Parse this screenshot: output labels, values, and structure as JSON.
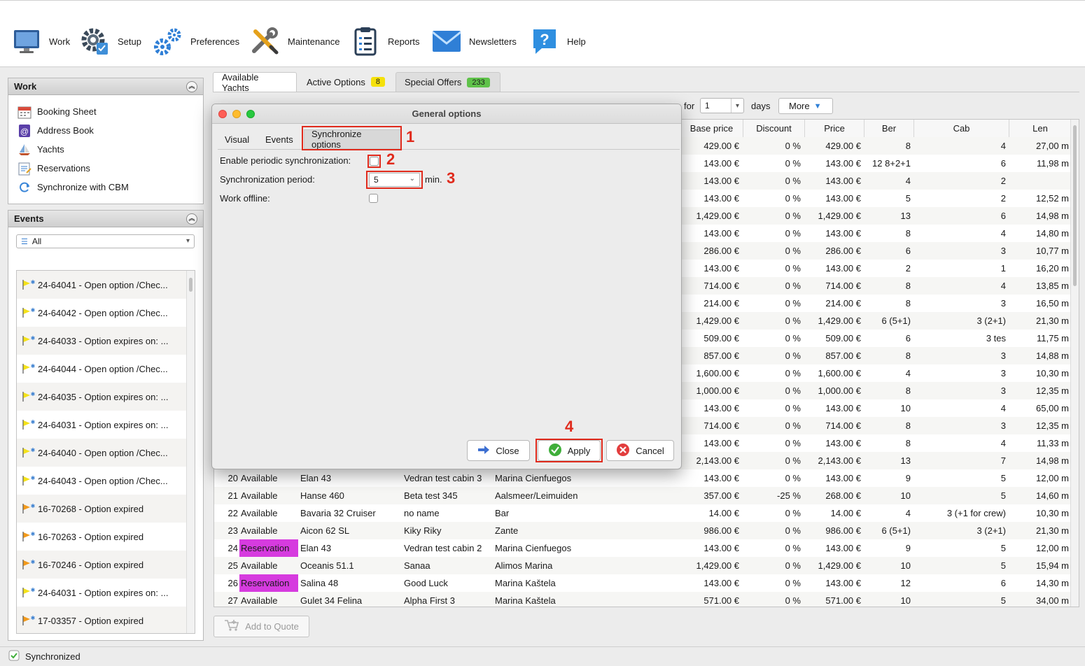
{
  "toolbar": {
    "items": [
      {
        "label": "Work",
        "icon": "monitor-icon"
      },
      {
        "label": "Setup",
        "icon": "gear-checklist-icon"
      },
      {
        "label": "Preferences",
        "icon": "gears-icon"
      },
      {
        "label": "Maintenance",
        "icon": "wrench-screwdriver-icon"
      },
      {
        "label": "Reports",
        "icon": "clipboard-icon"
      },
      {
        "label": "Newsletters",
        "icon": "envelope-icon"
      },
      {
        "label": "Help",
        "icon": "help-bubble-icon"
      }
    ]
  },
  "work_panel": {
    "title": "Work",
    "items": [
      {
        "label": "Booking Sheet",
        "icon": "calendar-icon"
      },
      {
        "label": "Address Book",
        "icon": "address-book-icon"
      },
      {
        "label": "Yachts",
        "icon": "sailboat-icon"
      },
      {
        "label": "Reservations",
        "icon": "notepad-icon"
      },
      {
        "label": "Synchronize with CBM",
        "icon": "sync-icon"
      }
    ]
  },
  "events_panel": {
    "title": "Events",
    "filter_value": "All",
    "events": [
      {
        "text": "24-64041 - Open option /Chec...",
        "flag": "yellow"
      },
      {
        "text": "24-64042 - Open option /Chec...",
        "flag": "yellow"
      },
      {
        "text": "24-64033 - Option expires on: ...",
        "flag": "yellow"
      },
      {
        "text": "24-64044 - Open option /Chec...",
        "flag": "yellow"
      },
      {
        "text": "24-64035 - Option expires on: ...",
        "flag": "yellow"
      },
      {
        "text": "24-64031 - Option expires on: ...",
        "flag": "yellow"
      },
      {
        "text": "24-64040 - Open option /Chec...",
        "flag": "yellow"
      },
      {
        "text": "24-64043 - Open option /Chec...",
        "flag": "yellow"
      },
      {
        "text": "16-70268 - Option expired",
        "flag": "orange"
      },
      {
        "text": "16-70263 - Option expired",
        "flag": "orange"
      },
      {
        "text": "16-70246 - Option expired",
        "flag": "orange"
      },
      {
        "text": "24-64031 - Option expires on: ...",
        "flag": "yellow"
      },
      {
        "text": "17-03357 - Option expired",
        "flag": "orange"
      }
    ]
  },
  "main_tabs": [
    {
      "label": "Available Yachts"
    },
    {
      "label": "Active Options",
      "badge": "8",
      "badge_color": "#f5e10a"
    },
    {
      "label": "Special Offers",
      "badge": "233",
      "badge_color": "#5fc24a"
    }
  ],
  "filters": {
    "for_label": "for",
    "days_value": "1",
    "days_label": "days",
    "more_label": "More"
  },
  "grid": {
    "columns": [
      "Base price",
      "Discount",
      "Price",
      "Ber",
      "Cab",
      "Len"
    ],
    "upper_rows": [
      [
        "429.00 €",
        "0 %",
        "429.00 €",
        "8",
        "4",
        "27,00 m"
      ],
      [
        "143.00 €",
        "0 %",
        "143.00 €",
        "12 8+2+1",
        "6",
        "11,98 m"
      ],
      [
        "143.00 €",
        "0 %",
        "143.00 €",
        "4",
        "2",
        ""
      ],
      [
        "143.00 €",
        "0 %",
        "143.00 €",
        "5",
        "2",
        "12,52 m"
      ],
      [
        "1,429.00 €",
        "0 %",
        "1,429.00 €",
        "13",
        "6",
        "14,98 m"
      ],
      [
        "143.00 €",
        "0 %",
        "143.00 €",
        "8",
        "4",
        "14,80 m"
      ],
      [
        "286.00 €",
        "0 %",
        "286.00 €",
        "6",
        "3",
        "10,77 m"
      ],
      [
        "143.00 €",
        "0 %",
        "143.00 €",
        "2",
        "1",
        "16,20 m"
      ],
      [
        "714.00 €",
        "0 %",
        "714.00 €",
        "8",
        "4",
        "13,85 m"
      ],
      [
        "214.00 €",
        "0 %",
        "214.00 €",
        "8",
        "3",
        "16,50 m"
      ],
      [
        "1,429.00 €",
        "0 %",
        "1,429.00 €",
        "6 (5+1)",
        "3 (2+1)",
        "21,30 m"
      ],
      [
        "509.00 €",
        "0 %",
        "509.00 €",
        "6",
        "3 tes",
        "11,75 m"
      ],
      [
        "857.00 €",
        "0 %",
        "857.00 €",
        "8",
        "3",
        "14,88 m"
      ],
      [
        "1,600.00 €",
        "0 %",
        "1,600.00 €",
        "4",
        "3",
        "10,30 m"
      ],
      [
        "1,000.00 €",
        "0 %",
        "1,000.00 €",
        "8",
        "3",
        "12,35 m"
      ],
      [
        "143.00 €",
        "0 %",
        "143.00 €",
        "10",
        "4",
        "65,00 m"
      ],
      [
        "714.00 €",
        "0 %",
        "714.00 €",
        "8",
        "3",
        "12,35 m"
      ],
      [
        "143.00 €",
        "0 %",
        "143.00 €",
        "8",
        "4",
        "11,33 m"
      ],
      [
        "2,143.00 €",
        "0 %",
        "2,143.00 €",
        "13",
        "7",
        "14,98 m"
      ]
    ],
    "lower_rows": [
      {
        "no": "20",
        "status": "Available",
        "model": "Elan 43",
        "name": "Vedran test cabin 3",
        "base": "Marina Cienfuegos",
        "base_price": "143.00 €",
        "discount": "0 %",
        "price": "143.00 €",
        "ber": "9",
        "cab": "5",
        "len": "12,00 m"
      },
      {
        "no": "21",
        "status": "Available",
        "model": "Hanse 460",
        "name": "Beta test 345",
        "base": "Aalsmeer/Leimuiden",
        "base_price": "357.00 €",
        "discount": "-25 %",
        "price": "268.00 €",
        "ber": "10",
        "cab": "5",
        "len": "14,60 m"
      },
      {
        "no": "22",
        "status": "Available",
        "model": "Bavaria 32 Cruiser",
        "name": "no name",
        "base": "Bar",
        "base_price": "14.00 €",
        "discount": "0 %",
        "price": "14.00 €",
        "ber": "4",
        "cab": "3 (+1 for crew)",
        "len": "10,30 m"
      },
      {
        "no": "23",
        "status": "Available",
        "model": "Aicon 62 SL",
        "name": "Kiky Riky",
        "base": "Zante",
        "base_price": "986.00 €",
        "discount": "0 %",
        "price": "986.00 €",
        "ber": "6 (5+1)",
        "cab": "3 (2+1)",
        "len": "21,30 m"
      },
      {
        "no": "24",
        "status": "Reservation",
        "model": "Elan 43",
        "name": "Vedran test cabin 2",
        "base": "Marina Cienfuegos",
        "base_price": "143.00 €",
        "discount": "0 %",
        "price": "143.00 €",
        "ber": "9",
        "cab": "5",
        "len": "12,00 m"
      },
      {
        "no": "25",
        "status": "Available",
        "model": "Oceanis 51.1",
        "name": "Sanaa",
        "base": "Alimos Marina",
        "base_price": "1,429.00 €",
        "discount": "0 %",
        "price": "1,429.00 €",
        "ber": "10",
        "cab": "5",
        "len": "15,94 m"
      },
      {
        "no": "26",
        "status": "Reservation",
        "model": "Salina 48",
        "name": "Good Luck",
        "base": "Marina Kaštela",
        "base_price": "143.00 €",
        "discount": "0 %",
        "price": "143.00 €",
        "ber": "12",
        "cab": "6",
        "len": "14,30 m"
      },
      {
        "no": "27",
        "status": "Available",
        "model": "Gulet 34 Felina",
        "name": "Alpha First 3",
        "base": "Marina Kaštela",
        "base_price": "571.00 €",
        "discount": "0 %",
        "price": "571.00 €",
        "ber": "10",
        "cab": "5",
        "len": "34,00 m"
      }
    ]
  },
  "dialog": {
    "title": "General options",
    "tabs": [
      "Visual",
      "Events",
      "Synchronize options"
    ],
    "active_tab": "Synchronize options",
    "enable_sync_label": "Enable periodic synchronization:",
    "enable_sync_checked": false,
    "period_label": "Synchronization period:",
    "period_value": "5",
    "period_unit": "min.",
    "offline_label": "Work offline:",
    "offline_checked": false,
    "close_label": "Close",
    "apply_label": "Apply",
    "cancel_label": "Cancel",
    "annotations": [
      "1",
      "2",
      "3",
      "4"
    ]
  },
  "add_quote_label": "Add to Quote",
  "status_text": "Synchronized",
  "colors": {
    "annotation_red": "#e02a1c",
    "reservation": "#d63bdf",
    "apply_green": "#3fae3a",
    "cancel_red": "#e23d3d"
  }
}
